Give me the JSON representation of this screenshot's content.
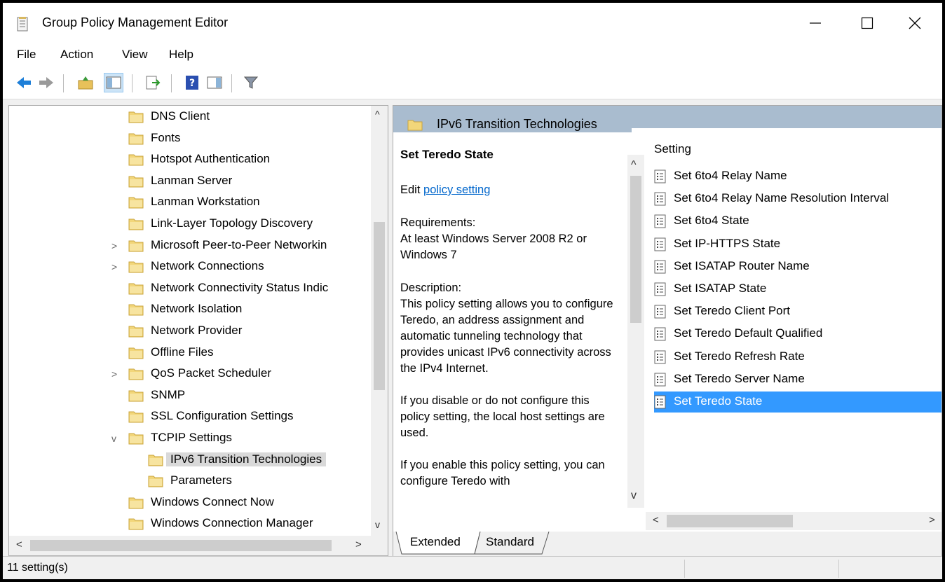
{
  "window": {
    "title": "Group Policy Management Editor",
    "minimize_label": "—",
    "maximize_label": "☐",
    "close_label": "✕"
  },
  "menu": [
    "File",
    "Action",
    "View",
    "Help"
  ],
  "toolbar": {
    "icons": [
      "back-arrow-icon",
      "forward-arrow-icon",
      "up-folder-icon",
      "show-hide-tree-icon",
      "export-list-icon",
      "help-icon",
      "show-hide-action-pane-icon",
      "filter-icon"
    ]
  },
  "tree": {
    "items": [
      {
        "label": "DNS Client",
        "expander": ""
      },
      {
        "label": "Fonts",
        "expander": ""
      },
      {
        "label": "Hotspot Authentication",
        "expander": ""
      },
      {
        "label": "Lanman Server",
        "expander": ""
      },
      {
        "label": "Lanman Workstation",
        "expander": ""
      },
      {
        "label": "Link-Layer Topology Discovery",
        "expander": ""
      },
      {
        "label": "Microsoft Peer-to-Peer Networkin",
        "expander": ">"
      },
      {
        "label": "Network Connections",
        "expander": ">"
      },
      {
        "label": "Network Connectivity Status Indic",
        "expander": ""
      },
      {
        "label": "Network Isolation",
        "expander": ""
      },
      {
        "label": "Network Provider",
        "expander": ""
      },
      {
        "label": "Offline Files",
        "expander": ""
      },
      {
        "label": "QoS Packet Scheduler",
        "expander": ">"
      },
      {
        "label": "SNMP",
        "expander": ""
      },
      {
        "label": "SSL Configuration Settings",
        "expander": ""
      },
      {
        "label": "TCPIP Settings",
        "expander": "v"
      },
      {
        "label": "IPv6 Transition Technologies",
        "expander": "",
        "selected": true
      },
      {
        "label": "Parameters",
        "expander": ""
      },
      {
        "label": "Windows Connect Now",
        "expander": ""
      },
      {
        "label": "Windows Connection Manager",
        "expander": ""
      }
    ],
    "scroll_up": "^",
    "scroll_down": "v",
    "scroll_left": "<",
    "scroll_right": ">"
  },
  "details": {
    "header_title": "IPv6 Transition Technologies",
    "policy_title": "Set Teredo State",
    "edit_prefix": "Edit ",
    "edit_link": "policy setting ",
    "requirements_label": "Requirements:",
    "requirements_text": "At least Windows Server 2008 R2 or Windows 7",
    "description_label": "Description:",
    "description_p1": "This policy setting allows you to configure Teredo, an address assignment and automatic tunneling technology that provides unicast IPv6 connectivity across the IPv4 Internet.",
    "description_p2": "If you disable or do not configure this policy setting, the local host settings are used.",
    "description_p3": "If you enable this policy setting, you can configure Teredo with"
  },
  "settings_list": {
    "column_header": "Setting",
    "items": [
      {
        "label": "Set 6to4 Relay Name"
      },
      {
        "label": "Set 6to4 Relay Name Resolution Interval"
      },
      {
        "label": "Set 6to4 State"
      },
      {
        "label": "Set IP-HTTPS State"
      },
      {
        "label": "Set ISATAP Router Name"
      },
      {
        "label": "Set ISATAP State"
      },
      {
        "label": "Set Teredo Client Port"
      },
      {
        "label": "Set Teredo Default Qualified"
      },
      {
        "label": "Set Teredo Refresh Rate"
      },
      {
        "label": "Set Teredo Server Name"
      },
      {
        "label": "Set Teredo State",
        "selected": true
      }
    ],
    "scroll_up": "^",
    "scroll_down": "v",
    "scroll_left": "<",
    "scroll_right": ">"
  },
  "bottom_tabs": [
    "Extended",
    "Standard"
  ],
  "status": {
    "text": "11 setting(s)"
  },
  "colors": {
    "selection": "#3399ff",
    "header_band": "#a9bccf",
    "link": "#0066cc"
  }
}
